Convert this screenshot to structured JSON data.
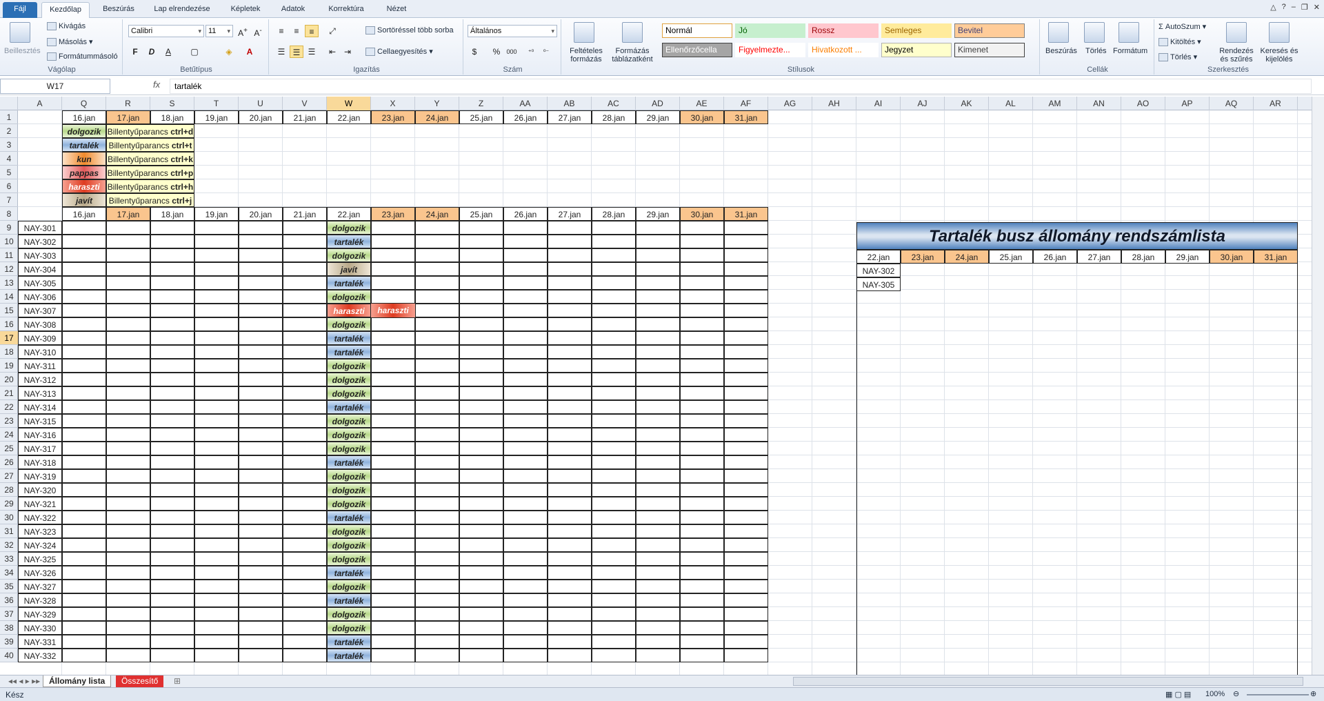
{
  "ribbon_tabs": [
    "Fájl",
    "Kezdőlap",
    "Beszúrás",
    "Lap elrendezése",
    "Képletek",
    "Adatok",
    "Korrektúra",
    "Nézet"
  ],
  "clipboard": {
    "paste": "Beillesztés",
    "cut": "Kivágás",
    "copy": "Másolás",
    "format_painter": "Formátummásoló",
    "label": "Vágólap"
  },
  "font": {
    "name": "Calibri",
    "size": "11",
    "bold": "F",
    "italic": "D",
    "underline": "A",
    "label": "Betűtípus"
  },
  "alignment": {
    "wrap": "Sortöréssel több sorba",
    "merge": "Cellaegyesítés",
    "label": "Igazítás"
  },
  "number": {
    "format": "Általános",
    "percent": "%",
    "thousands": "000",
    "label": "Szám"
  },
  "styles": {
    "cond_format": "Feltételes formázás",
    "table_format": "Formázás táblázatként",
    "label": "Stílusok",
    "cells": [
      {
        "t": "Normál",
        "bg": "#ffffff",
        "fg": "#000000",
        "bd": "#e0a13c"
      },
      {
        "t": "Jó",
        "bg": "#c6efce",
        "fg": "#006100",
        "bd": "#c6efce"
      },
      {
        "t": "Rossz",
        "bg": "#ffc7ce",
        "fg": "#9c0006",
        "bd": "#ffc7ce"
      },
      {
        "t": "Semleges",
        "bg": "#ffeb9c",
        "fg": "#9c6500",
        "bd": "#ffeb9c"
      },
      {
        "t": "Bevitel",
        "bg": "#ffcc99",
        "fg": "#3f3f76",
        "bd": "#7f7f7f"
      },
      {
        "t": "Ellenőrzőcella",
        "bg": "#a5a5a5",
        "fg": "#ffffff",
        "bd": "#3f3f3f"
      },
      {
        "t": "Figyelmezte...",
        "bg": "#ffffff",
        "fg": "#ff0000",
        "bd": "#ffffff"
      },
      {
        "t": "Hivatkozott ...",
        "bg": "#ffffff",
        "fg": "#fa7d00",
        "bd": "#ffffff"
      },
      {
        "t": "Jegyzet",
        "bg": "#ffffcc",
        "fg": "#000000",
        "bd": "#b2b2b2"
      },
      {
        "t": "Kimenet",
        "bg": "#f2f2f2",
        "fg": "#3f3f3f",
        "bd": "#3f3f3f"
      }
    ]
  },
  "cells_group": {
    "insert": "Beszúrás",
    "delete": "Törlés",
    "format": "Formátum",
    "label": "Cellák"
  },
  "editing": {
    "autosum": "AutoSzum",
    "fill": "Kitöltés",
    "clear": "Törlés",
    "sort": "Rendezés és szűrés",
    "find": "Keresés és kijelölés",
    "label": "Szerkesztés"
  },
  "namebox": "W17",
  "fx": "fx",
  "formula": "tartalék",
  "columns": [
    "A",
    "Q",
    "R",
    "S",
    "T",
    "U",
    "V",
    "W",
    "X",
    "Y",
    "Z",
    "AA",
    "AB",
    "AC",
    "AD",
    "AE",
    "AF",
    "AG",
    "AH",
    "AI",
    "AJ",
    "AK",
    "AL",
    "AM",
    "AN",
    "AO",
    "AP",
    "AQ",
    "AR"
  ],
  "rows": [
    "1",
    "2",
    "3",
    "4",
    "5",
    "6",
    "7",
    "8",
    "9",
    "10",
    "11",
    "12",
    "13",
    "14",
    "15",
    "16",
    "17",
    "18",
    "19",
    "20",
    "21",
    "22",
    "23",
    "24",
    "25",
    "26",
    "27",
    "28",
    "29",
    "30",
    "31",
    "32",
    "33",
    "34",
    "35",
    "36",
    "37",
    "38",
    "39",
    "40"
  ],
  "dates": [
    "16.jan",
    "17.jan",
    "18.jan",
    "19.jan",
    "20.jan",
    "21.jan",
    "22.jan",
    "23.jan",
    "24.jan",
    "25.jan",
    "26.jan",
    "27.jan",
    "28.jan",
    "29.jan",
    "30.jan",
    "31.jan"
  ],
  "legend": [
    {
      "status": "dolgozik",
      "cls": "dolgozik",
      "hint": "Billentyűparancs ",
      "key": "ctrl+d"
    },
    {
      "status": "tartalék",
      "cls": "tartalek",
      "hint": "Billentyűparancs ",
      "key": "ctrl+t"
    },
    {
      "status": "kun",
      "cls": "kun",
      "hint": "Billentyűparancs ",
      "key": "ctrl+k"
    },
    {
      "status": "pappas",
      "cls": "pappas",
      "hint": "Billentyűparancs ",
      "key": "ctrl+p"
    },
    {
      "status": "haraszti",
      "cls": "haraszti",
      "hint": "Billentyűparancs ",
      "key": "ctrl+h"
    },
    {
      "status": "javít",
      "cls": "javit",
      "hint": "Billentyűparancs ",
      "key": "ctrl+j"
    }
  ],
  "buses": [
    [
      "NAY-301",
      "dolgozik"
    ],
    [
      "NAY-302",
      "tartalék"
    ],
    [
      "NAY-303",
      "dolgozik"
    ],
    [
      "NAY-304",
      "javít"
    ],
    [
      "NAY-305",
      "tartalék"
    ],
    [
      "NAY-306",
      "dolgozik"
    ],
    [
      "NAY-307",
      "haraszti"
    ],
    [
      "NAY-308",
      "dolgozik"
    ],
    [
      "NAY-309",
      "tartalék"
    ],
    [
      "NAY-310",
      "tartalék"
    ],
    [
      "NAY-311",
      "dolgozik"
    ],
    [
      "NAY-312",
      "dolgozik"
    ],
    [
      "NAY-313",
      "dolgozik"
    ],
    [
      "NAY-314",
      "tartalék"
    ],
    [
      "NAY-315",
      "dolgozik"
    ],
    [
      "NAY-316",
      "dolgozik"
    ],
    [
      "NAY-317",
      "dolgozik"
    ],
    [
      "NAY-318",
      "tartalék"
    ],
    [
      "NAY-319",
      "dolgozik"
    ],
    [
      "NAY-320",
      "dolgozik"
    ],
    [
      "NAY-321",
      "dolgozik"
    ],
    [
      "NAY-322",
      "tartalék"
    ],
    [
      "NAY-323",
      "dolgozik"
    ],
    [
      "NAY-324",
      "dolgozik"
    ],
    [
      "NAY-325",
      "dolgozik"
    ],
    [
      "NAY-326",
      "tartalék"
    ],
    [
      "NAY-327",
      "dolgozik"
    ],
    [
      "NAY-328",
      "tartalék"
    ],
    [
      "NAY-329",
      "dolgozik"
    ],
    [
      "NAY-330",
      "dolgozik"
    ],
    [
      "NAY-331",
      "tartalék"
    ],
    [
      "NAY-332",
      "tartalék"
    ]
  ],
  "extra_x": "haraszti",
  "reserve": {
    "title": "Tartalék busz állomány rendszámlista",
    "dates": [
      "22.jan",
      "23.jan",
      "24.jan",
      "25.jan",
      "26.jan",
      "27.jan",
      "28.jan",
      "29.jan",
      "30.jan",
      "31.jan"
    ],
    "plates": [
      "NAY-302",
      "NAY-305"
    ]
  },
  "sheets": [
    "Állomány lista",
    "Összesítő"
  ],
  "status": "Kész",
  "zoom": "100%"
}
